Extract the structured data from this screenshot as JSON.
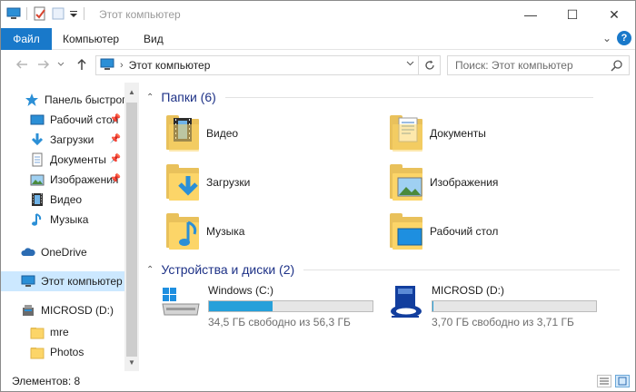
{
  "window": {
    "title": "Этот компьютер"
  },
  "titlebar": {
    "minimize": "—",
    "maximize": "☐",
    "close": "✕"
  },
  "ribbon": {
    "file_tab": "Файл",
    "tabs": [
      "Компьютер",
      "Вид"
    ],
    "help": "?",
    "expand": "⌄"
  },
  "address": {
    "location": "Этот компьютер",
    "search_placeholder": "Поиск: Этот компьютер"
  },
  "nav": {
    "items": [
      {
        "label": "Панель быстрого доступа",
        "icon": "star-icon"
      },
      {
        "label": "Рабочий стол",
        "icon": "desktop-icon",
        "pinned": true
      },
      {
        "label": "Загрузки",
        "icon": "download-icon",
        "pinned": true
      },
      {
        "label": "Документы",
        "icon": "documents-icon",
        "pinned": true
      },
      {
        "label": "Изображения",
        "icon": "pictures-icon",
        "pinned": true
      },
      {
        "label": "Видео",
        "icon": "video-icon"
      },
      {
        "label": "Музыка",
        "icon": "music-icon"
      },
      {
        "label": "OneDrive",
        "icon": "cloud-icon"
      },
      {
        "label": "Этот компьютер",
        "icon": "computer-icon",
        "selected": true
      },
      {
        "label": "MICROSD (D:)",
        "icon": "usb-drive-icon"
      },
      {
        "label": "mre",
        "icon": "folder-icon"
      },
      {
        "label": "Photos",
        "icon": "folder-icon"
      }
    ]
  },
  "content": {
    "folders_header": "Папки (6)",
    "folders": [
      {
        "label": "Видео",
        "icon": "video-folder-icon"
      },
      {
        "label": "Документы",
        "icon": "documents-folder-icon"
      },
      {
        "label": "Загрузки",
        "icon": "downloads-folder-icon"
      },
      {
        "label": "Изображения",
        "icon": "pictures-folder-icon"
      },
      {
        "label": "Музыка",
        "icon": "music-folder-icon"
      },
      {
        "label": "Рабочий стол",
        "icon": "desktop-folder-icon"
      }
    ],
    "drives_header": "Устройства и диски (2)",
    "drives": [
      {
        "label": "Windows (C:)",
        "free": "34,5 ГБ свободно из 56,3 ГБ",
        "used_fraction": 0.387
      },
      {
        "label": "MICROSD (D:)",
        "free": "3,70 ГБ свободно из 3,71 ГБ",
        "used_fraction": 0.003
      }
    ]
  },
  "status": {
    "items": "Элементов: 8"
  },
  "colors": {
    "accent": "#1979ca",
    "selection": "#cce8ff",
    "folder": "#fcd568",
    "bar_fill": "#26a0da",
    "header": "#1e3287"
  }
}
